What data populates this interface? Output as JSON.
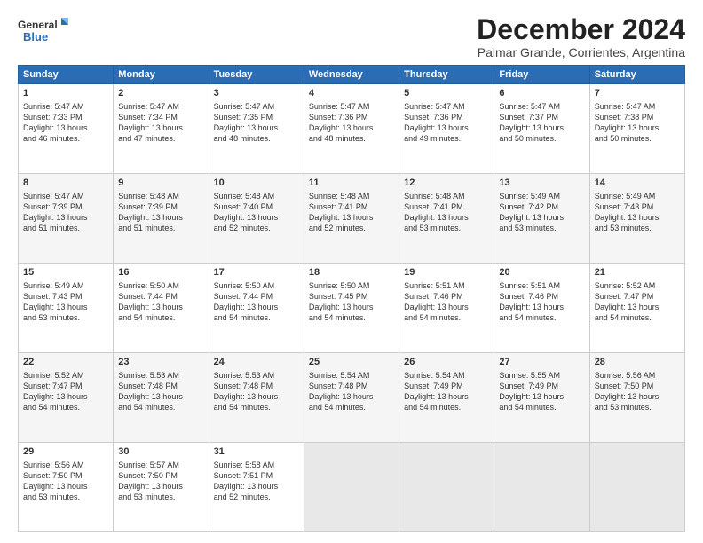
{
  "logo": {
    "line1": "General",
    "line2": "Blue"
  },
  "title": "December 2024",
  "subtitle": "Palmar Grande, Corrientes, Argentina",
  "days_header": [
    "Sunday",
    "Monday",
    "Tuesday",
    "Wednesday",
    "Thursday",
    "Friday",
    "Saturday"
  ],
  "weeks": [
    [
      {
        "day": "1",
        "lines": [
          "Sunrise: 5:47 AM",
          "Sunset: 7:33 PM",
          "Daylight: 13 hours",
          "and 46 minutes."
        ]
      },
      {
        "day": "2",
        "lines": [
          "Sunrise: 5:47 AM",
          "Sunset: 7:34 PM",
          "Daylight: 13 hours",
          "and 47 minutes."
        ]
      },
      {
        "day": "3",
        "lines": [
          "Sunrise: 5:47 AM",
          "Sunset: 7:35 PM",
          "Daylight: 13 hours",
          "and 48 minutes."
        ]
      },
      {
        "day": "4",
        "lines": [
          "Sunrise: 5:47 AM",
          "Sunset: 7:36 PM",
          "Daylight: 13 hours",
          "and 48 minutes."
        ]
      },
      {
        "day": "5",
        "lines": [
          "Sunrise: 5:47 AM",
          "Sunset: 7:36 PM",
          "Daylight: 13 hours",
          "and 49 minutes."
        ]
      },
      {
        "day": "6",
        "lines": [
          "Sunrise: 5:47 AM",
          "Sunset: 7:37 PM",
          "Daylight: 13 hours",
          "and 50 minutes."
        ]
      },
      {
        "day": "7",
        "lines": [
          "Sunrise: 5:47 AM",
          "Sunset: 7:38 PM",
          "Daylight: 13 hours",
          "and 50 minutes."
        ]
      }
    ],
    [
      {
        "day": "8",
        "lines": [
          "Sunrise: 5:47 AM",
          "Sunset: 7:39 PM",
          "Daylight: 13 hours",
          "and 51 minutes."
        ]
      },
      {
        "day": "9",
        "lines": [
          "Sunrise: 5:48 AM",
          "Sunset: 7:39 PM",
          "Daylight: 13 hours",
          "and 51 minutes."
        ]
      },
      {
        "day": "10",
        "lines": [
          "Sunrise: 5:48 AM",
          "Sunset: 7:40 PM",
          "Daylight: 13 hours",
          "and 52 minutes."
        ]
      },
      {
        "day": "11",
        "lines": [
          "Sunrise: 5:48 AM",
          "Sunset: 7:41 PM",
          "Daylight: 13 hours",
          "and 52 minutes."
        ]
      },
      {
        "day": "12",
        "lines": [
          "Sunrise: 5:48 AM",
          "Sunset: 7:41 PM",
          "Daylight: 13 hours",
          "and 53 minutes."
        ]
      },
      {
        "day": "13",
        "lines": [
          "Sunrise: 5:49 AM",
          "Sunset: 7:42 PM",
          "Daylight: 13 hours",
          "and 53 minutes."
        ]
      },
      {
        "day": "14",
        "lines": [
          "Sunrise: 5:49 AM",
          "Sunset: 7:43 PM",
          "Daylight: 13 hours",
          "and 53 minutes."
        ]
      }
    ],
    [
      {
        "day": "15",
        "lines": [
          "Sunrise: 5:49 AM",
          "Sunset: 7:43 PM",
          "Daylight: 13 hours",
          "and 53 minutes."
        ]
      },
      {
        "day": "16",
        "lines": [
          "Sunrise: 5:50 AM",
          "Sunset: 7:44 PM",
          "Daylight: 13 hours",
          "and 54 minutes."
        ]
      },
      {
        "day": "17",
        "lines": [
          "Sunrise: 5:50 AM",
          "Sunset: 7:44 PM",
          "Daylight: 13 hours",
          "and 54 minutes."
        ]
      },
      {
        "day": "18",
        "lines": [
          "Sunrise: 5:50 AM",
          "Sunset: 7:45 PM",
          "Daylight: 13 hours",
          "and 54 minutes."
        ]
      },
      {
        "day": "19",
        "lines": [
          "Sunrise: 5:51 AM",
          "Sunset: 7:46 PM",
          "Daylight: 13 hours",
          "and 54 minutes."
        ]
      },
      {
        "day": "20",
        "lines": [
          "Sunrise: 5:51 AM",
          "Sunset: 7:46 PM",
          "Daylight: 13 hours",
          "and 54 minutes."
        ]
      },
      {
        "day": "21",
        "lines": [
          "Sunrise: 5:52 AM",
          "Sunset: 7:47 PM",
          "Daylight: 13 hours",
          "and 54 minutes."
        ]
      }
    ],
    [
      {
        "day": "22",
        "lines": [
          "Sunrise: 5:52 AM",
          "Sunset: 7:47 PM",
          "Daylight: 13 hours",
          "and 54 minutes."
        ]
      },
      {
        "day": "23",
        "lines": [
          "Sunrise: 5:53 AM",
          "Sunset: 7:48 PM",
          "Daylight: 13 hours",
          "and 54 minutes."
        ]
      },
      {
        "day": "24",
        "lines": [
          "Sunrise: 5:53 AM",
          "Sunset: 7:48 PM",
          "Daylight: 13 hours",
          "and 54 minutes."
        ]
      },
      {
        "day": "25",
        "lines": [
          "Sunrise: 5:54 AM",
          "Sunset: 7:48 PM",
          "Daylight: 13 hours",
          "and 54 minutes."
        ]
      },
      {
        "day": "26",
        "lines": [
          "Sunrise: 5:54 AM",
          "Sunset: 7:49 PM",
          "Daylight: 13 hours",
          "and 54 minutes."
        ]
      },
      {
        "day": "27",
        "lines": [
          "Sunrise: 5:55 AM",
          "Sunset: 7:49 PM",
          "Daylight: 13 hours",
          "and 54 minutes."
        ]
      },
      {
        "day": "28",
        "lines": [
          "Sunrise: 5:56 AM",
          "Sunset: 7:50 PM",
          "Daylight: 13 hours",
          "and 53 minutes."
        ]
      }
    ],
    [
      {
        "day": "29",
        "lines": [
          "Sunrise: 5:56 AM",
          "Sunset: 7:50 PM",
          "Daylight: 13 hours",
          "and 53 minutes."
        ]
      },
      {
        "day": "30",
        "lines": [
          "Sunrise: 5:57 AM",
          "Sunset: 7:50 PM",
          "Daylight: 13 hours",
          "and 53 minutes."
        ]
      },
      {
        "day": "31",
        "lines": [
          "Sunrise: 5:58 AM",
          "Sunset: 7:51 PM",
          "Daylight: 13 hours",
          "and 52 minutes."
        ]
      },
      null,
      null,
      null,
      null
    ]
  ]
}
